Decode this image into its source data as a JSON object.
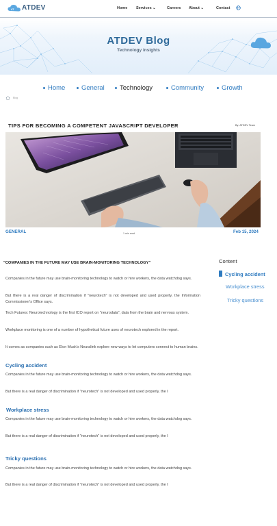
{
  "header": {
    "logo_text": "ATDEV",
    "nav": {
      "home": "Home",
      "services": "Services ⌄",
      "careers": "Careers",
      "about": "About ⌄",
      "contact": "Contact"
    },
    "language_icon": "globe-icon"
  },
  "hero": {
    "title": "ATDEV Blog",
    "subtitle": "Technology insights"
  },
  "categories": [
    "Home",
    "General",
    "Technology",
    "Community",
    "Growth"
  ],
  "active_category": "Technology",
  "breadcrumb": {
    "label": "Blog"
  },
  "article": {
    "title": "TIPS FOR BECOMING A COMPETENT JAVASCRIPT DEVELOPER",
    "author": "By: ATDEV Team",
    "category": "GENERAL",
    "read_time": "1 min read",
    "date": "Feb 15, 2024",
    "quote": "\"COMPANIES IN THE FUTURE MAY USE BRAIN-MONITORING TECHNOLOGY\"",
    "paragraphs": [
      "Companies in the future may use brain-monitoring technology to watch or hire workers, the data watchdog says.",
      "But there is a real danger of discrimination if \"neurotech\" is not developed and used properly, the Information Commissioner's Office says.",
      "Tech Futures: Neurotechnology is the first ICO report on \"neurodata\", data from the brain and nervous system.",
      "Workplace monitoring is one of a number of hypothetical future uses of neurotech explored in the report.",
      "It comes as companies such as Elon Musk's Neuralink explore new ways to let computers connect to human brains."
    ],
    "sections": [
      {
        "heading": "Cycling accident",
        "p1": "Companies in the future may use brain-monitoring technology to watch or hire workers, the data watchdog says.",
        "p2": "But there is a real danger of discrimination if \"neurotech\" is not developed and used properly, the I"
      },
      {
        "heading": "Workplace stress",
        "p1": "Companies in the future may use brain-monitoring technology to watch or hire workers, the data watchdog says.",
        "p2": "But there is a real danger of discrimination if \"neurotech\" is not developed and used properly, the I"
      },
      {
        "heading": "Tricky questions",
        "p1": "Companies in the future may use brain-monitoring technology to watch or hire workers, the data watchdog says.",
        "p2": "But there is a real danger of discrimination if \"neurotech\" is not developed and used properly, the I"
      }
    ]
  },
  "toc": {
    "title": "Content",
    "items": [
      "Cycling accident",
      "Workplace stress",
      "Tricky questions"
    ],
    "active": "Cycling accident"
  },
  "colors": {
    "accent": "#2f7bc0",
    "hero_title": "#2f6a9a"
  }
}
